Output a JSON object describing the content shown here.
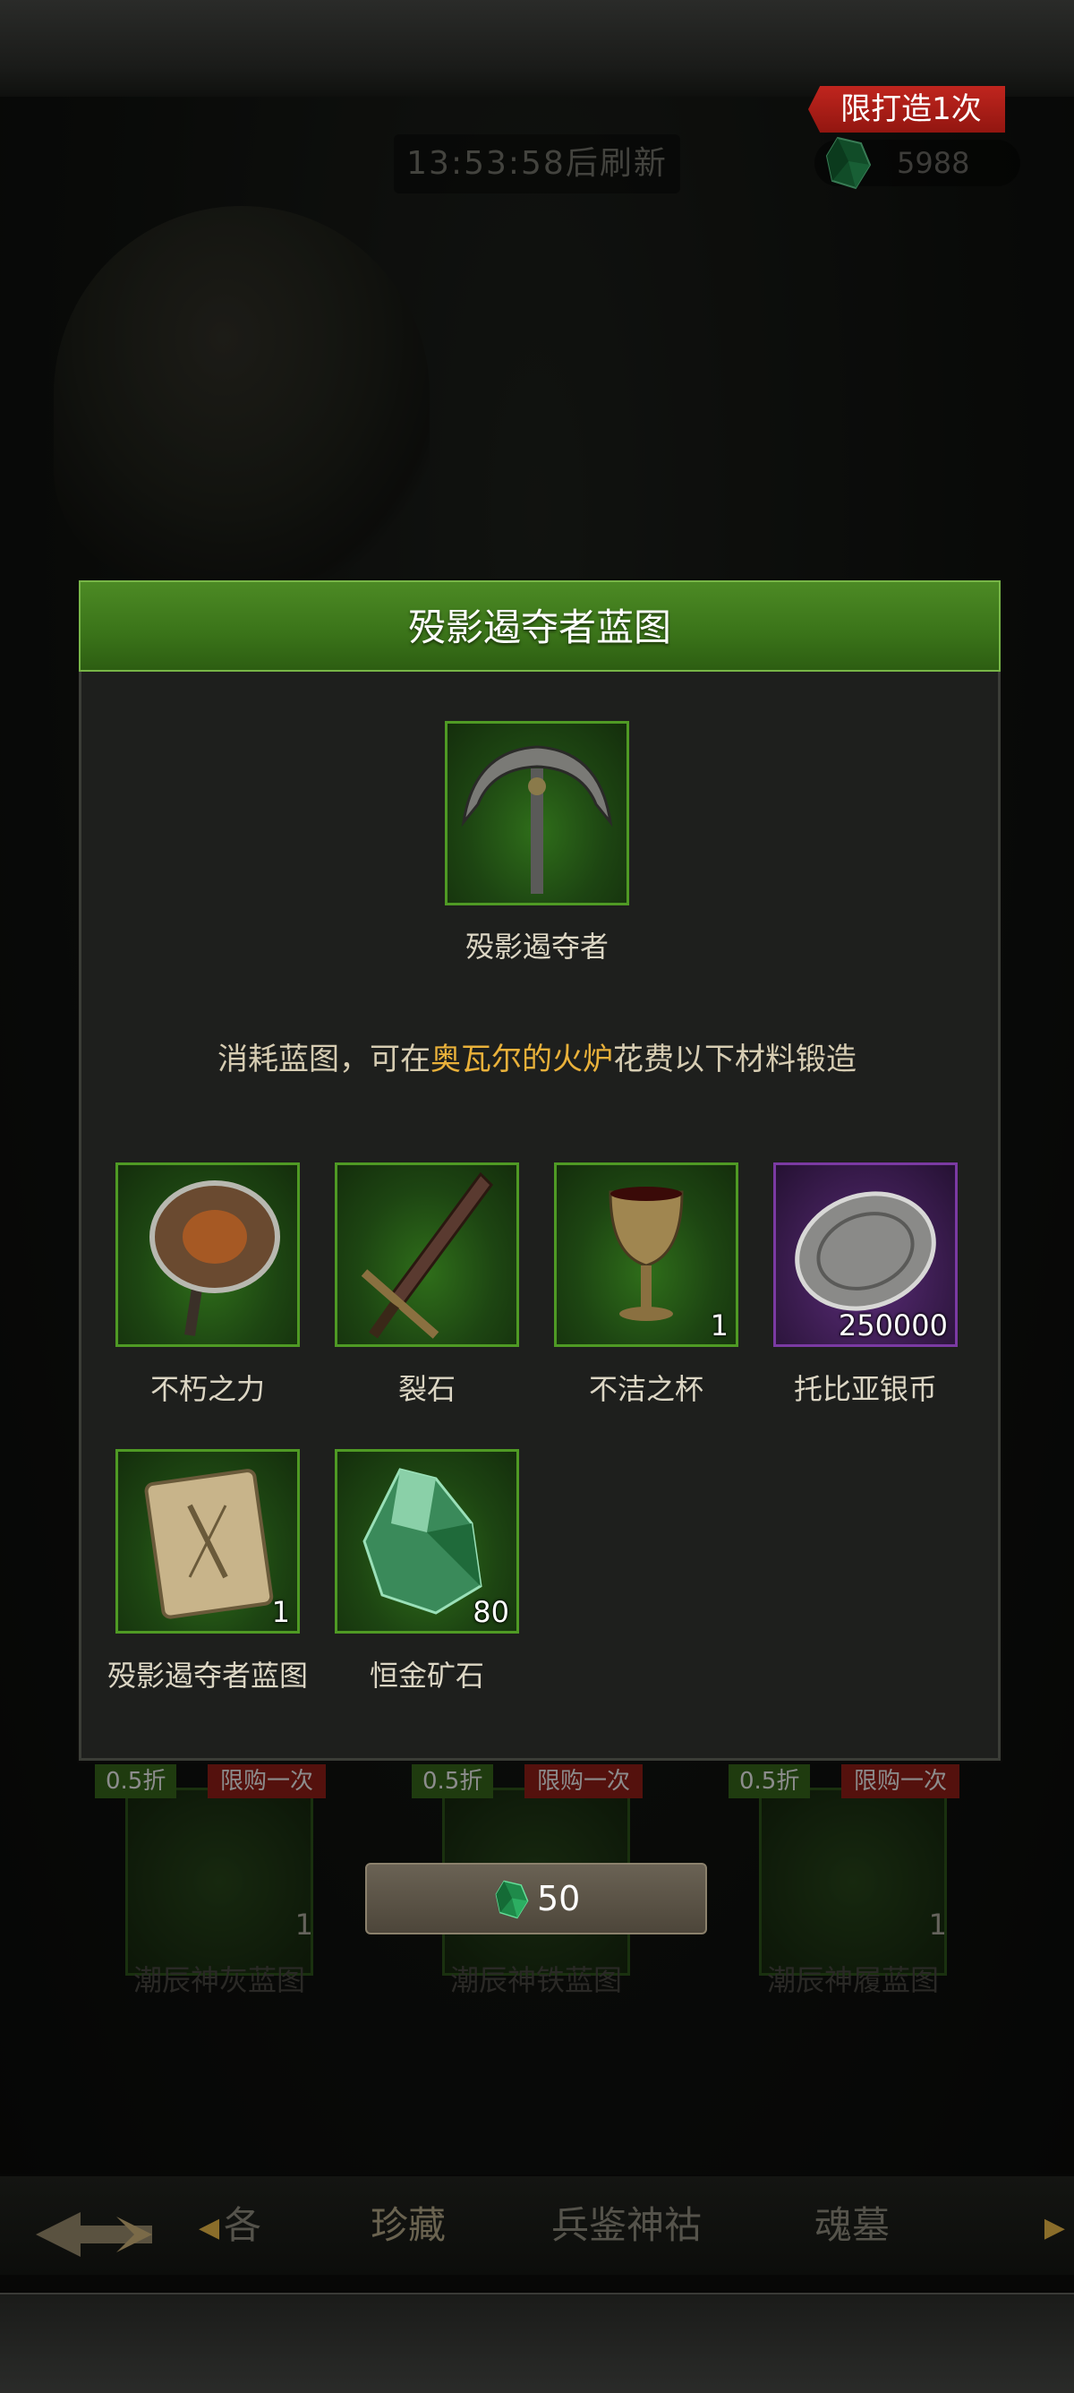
{
  "header": {
    "refresh_timer": "13:53:58后刷新",
    "currency_amount": "5988",
    "currency_icon": "green-gem-icon"
  },
  "dialog": {
    "title": "殁影遏夺者蓝图",
    "limit_tag": "限打造1次",
    "result_item": {
      "name": "殁影遏夺者",
      "icon": "anchor-weapon-icon"
    },
    "description_prefix": "消耗蓝图，可在",
    "description_highlight": "奥瓦尔的火炉",
    "description_suffix": "花费以下材料锻造",
    "materials": [
      {
        "name": "不朽之力",
        "icon": "winged-axe-icon",
        "count": ""
      },
      {
        "name": "裂石",
        "icon": "greatsword-icon",
        "count": ""
      },
      {
        "name": "不洁之杯",
        "icon": "goblet-icon",
        "count": "1"
      },
      {
        "name": "托比亚银币",
        "icon": "silver-coin-icon",
        "count": "250000"
      },
      {
        "name": "殁影遏夺者蓝图",
        "icon": "blueprint-scroll-icon",
        "count": "1"
      },
      {
        "name": "恒金矿石",
        "icon": "ore-crystal-icon",
        "count": "80"
      }
    ]
  },
  "shop_cards": [
    {
      "discount": "0.5折",
      "limit": "限购一次",
      "count": "1",
      "name": "潮辰神灰蓝图"
    },
    {
      "discount": "0.5折",
      "limit": "限购一次",
      "count": "",
      "name": "潮辰神铁蓝图"
    },
    {
      "discount": "0.5折",
      "limit": "限购一次",
      "count": "1",
      "name": "潮辰神履蓝图"
    }
  ],
  "buy_button": {
    "price": "50",
    "icon": "green-gem-icon"
  },
  "tabs": [
    {
      "label": "各",
      "active": false
    },
    {
      "label": "珍藏",
      "active": true
    },
    {
      "label": "兵鉴神祜",
      "active": false
    },
    {
      "label": "魂墓",
      "active": false
    }
  ]
}
